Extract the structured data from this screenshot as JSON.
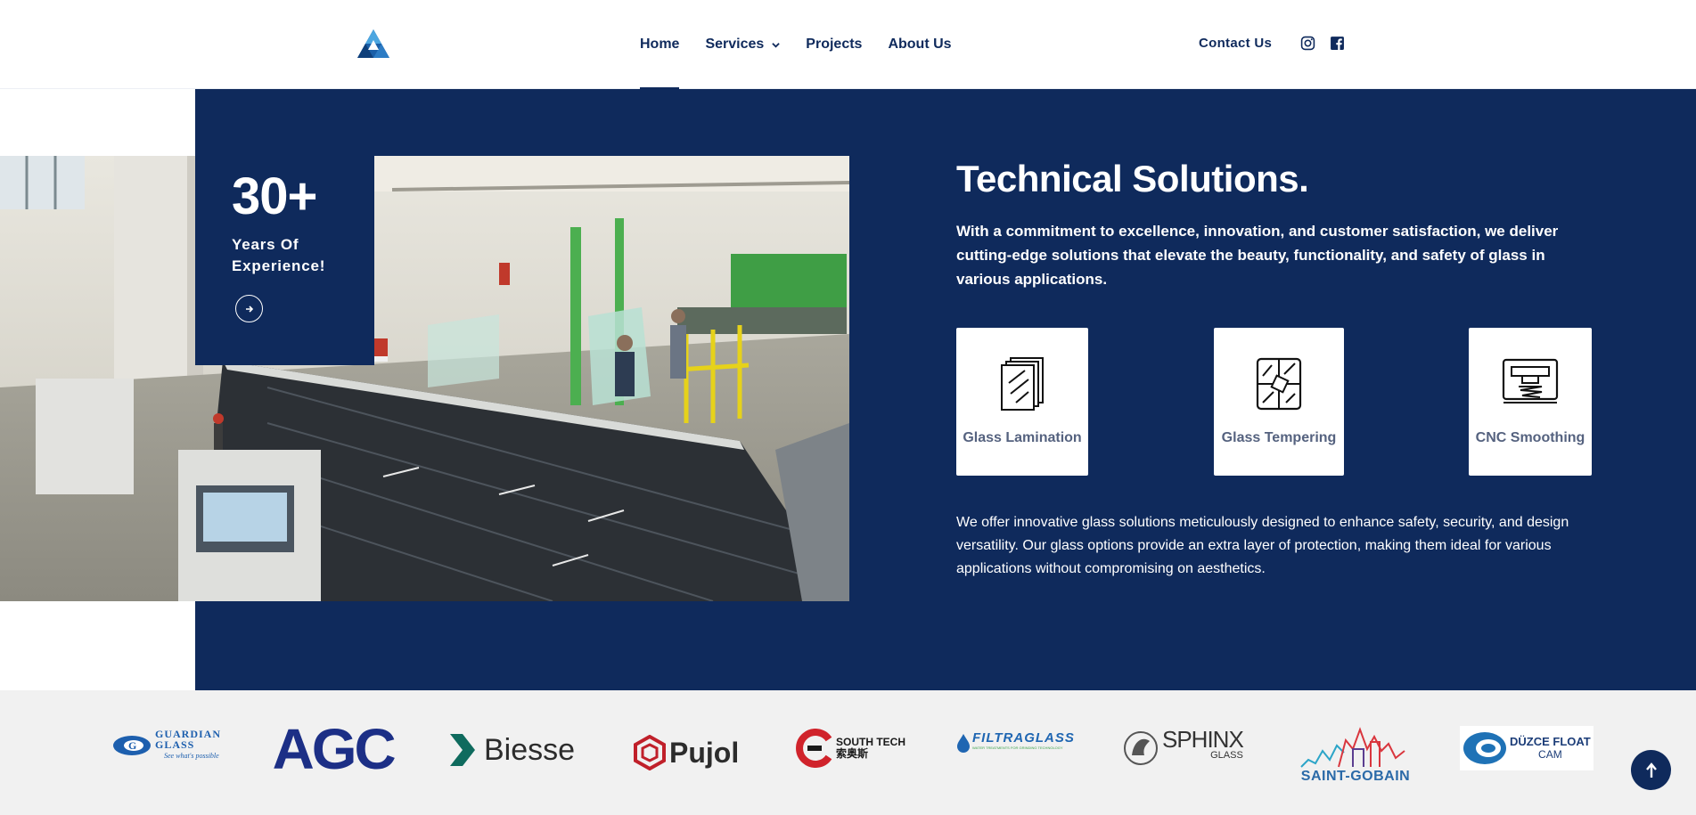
{
  "nav": {
    "items": [
      {
        "label": "Home"
      },
      {
        "label": "Services"
      },
      {
        "label": "Projects"
      },
      {
        "label": "About Us"
      }
    ],
    "contact_label": "Contact Us",
    "social": [
      "instagram-icon",
      "facebook-icon"
    ]
  },
  "experience": {
    "number": "30+",
    "label": "Years Of Experience!"
  },
  "section": {
    "title": "Technical Solutions.",
    "lead": "With a commitment to excellence, innovation, and customer satisfaction, we deliver cutting-edge solutions that elevate the beauty, functionality, and safety of glass in various applications.",
    "body": "We offer innovative glass solutions meticulously designed to enhance safety, security, and design versatility. Our glass options provide an extra layer of protection, making them ideal for various applications without compromising on aesthetics."
  },
  "cards": [
    {
      "label": "Glass Lamination",
      "icon": "glass-lamination-icon"
    },
    {
      "label": "Glass Tempering",
      "icon": "glass-tempering-icon"
    },
    {
      "label": "CNC Smoothing",
      "icon": "cnc-smoothing-icon"
    }
  ],
  "brands": {
    "guardian": {
      "line1": "GUARDIAN",
      "line2": "GLASS",
      "tagline": "See what's possible"
    },
    "agc": "AGC",
    "biesse": "Biesse",
    "pujol": "Pujol",
    "southtech": {
      "name": "SOUTH TECH",
      "cn": "索奥斯"
    },
    "filtraglass": {
      "name": "FILTRAGLASS",
      "tagline": "WATER TREATMENTS FOR GRINDING TECHNOLOGY"
    },
    "sphinx": {
      "name": "SPHINX",
      "sub": "GLASS"
    },
    "saint_gobain": "SAINT-GOBAIN",
    "duzce": {
      "line1": "DÜZCE FLOAT",
      "line2": "CAM"
    }
  },
  "colors": {
    "brand_navy": "#0f2a5c",
    "card_text": "#55627f",
    "strip_bg": "#f1f1f1"
  }
}
